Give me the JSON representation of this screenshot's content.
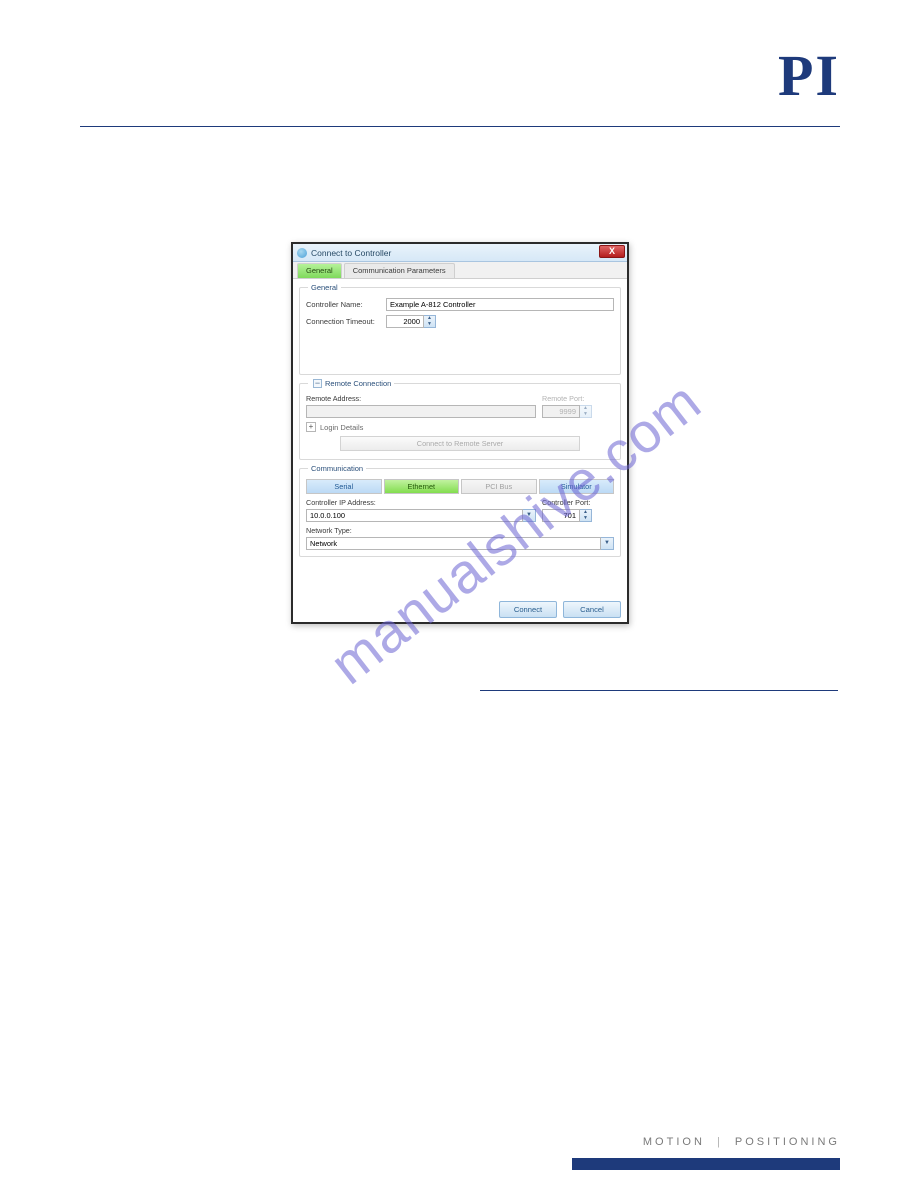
{
  "brand": {
    "logo": "PI"
  },
  "watermark": "manualshive.com",
  "footer": {
    "left": "MOTION",
    "right": "POSITIONING"
  },
  "dialog": {
    "title": "Connect to Controller",
    "close": "X",
    "tabs": {
      "general": "General",
      "comm_params": "Communication Parameters"
    },
    "general": {
      "legend": "General",
      "name_label": "Controller Name:",
      "name_value": "Example A-812 Controller",
      "timeout_label": "Connection Timeout:",
      "timeout_value": "2000"
    },
    "remote": {
      "legend": "Remote Connection",
      "addr_label": "Remote Address:",
      "addr_value": "",
      "port_label": "Remote Port:",
      "port_value": "9999",
      "login_label": "Login Details",
      "connect_label": "Connect to Remote Server"
    },
    "comm": {
      "legend": "Communication",
      "tabs": {
        "serial": "Serial",
        "ethernet": "Ethernet",
        "pci": "PCI Bus",
        "sim": "Simulator"
      },
      "ip_label": "Controller IP Address:",
      "ip_value": "10.0.0.100",
      "ctrl_port_label": "Controller Port:",
      "ctrl_port_value": "701",
      "net_type_label": "Network Type:",
      "net_type_value": "Network"
    },
    "buttons": {
      "connect": "Connect",
      "cancel": "Cancel"
    }
  }
}
